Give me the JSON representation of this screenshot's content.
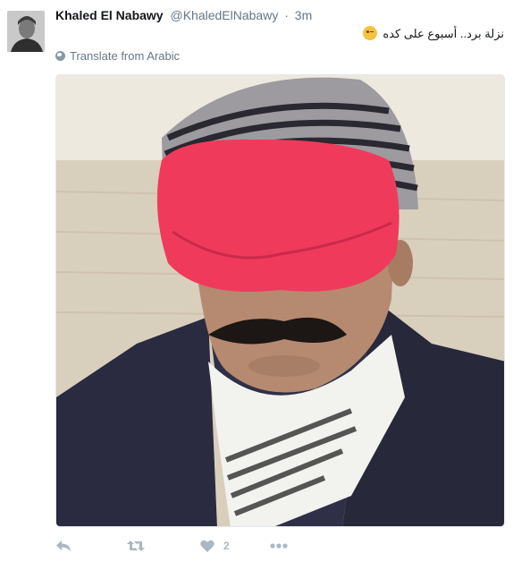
{
  "tweet": {
    "author_name": "Khaled El Nabawy",
    "author_handle": "@KhaledElNabawy",
    "separator": "·",
    "time": "3m",
    "text": "نزلة برد.. أسبوع على كده",
    "emoji": "winking-face",
    "translate_label": "Translate from Arabic",
    "like_count": "2"
  },
  "icons": {
    "translate": "globe-icon",
    "reply": "reply-icon",
    "retweet": "retweet-icon",
    "like": "heart-icon",
    "more": "more-dots-icon"
  },
  "colors": {
    "name": "#14171a",
    "secondary": "#657786",
    "action_icon": "#aab8c2",
    "mask": "#f03a5c"
  }
}
